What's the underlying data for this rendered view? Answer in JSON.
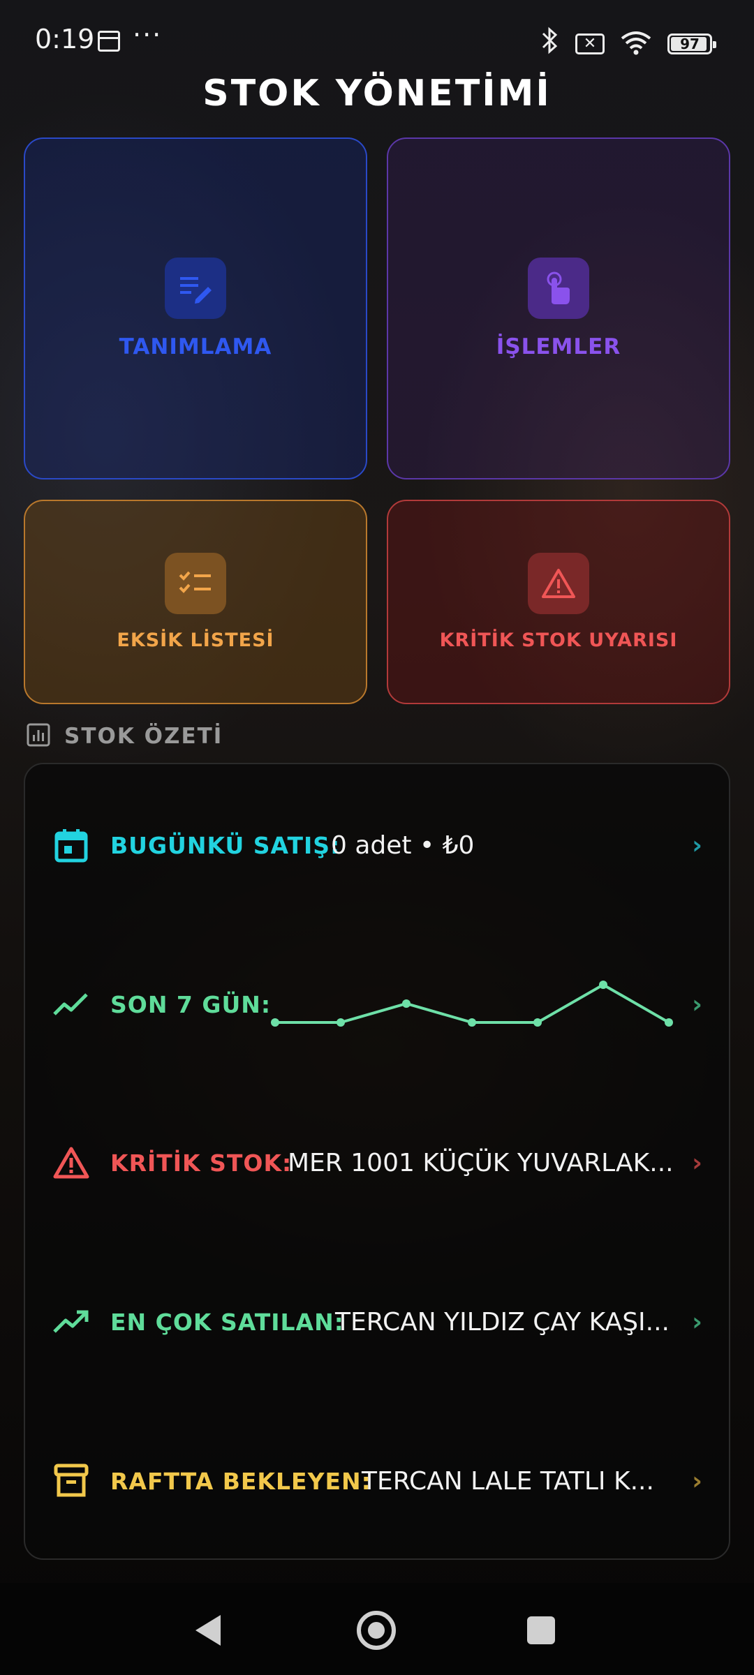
{
  "status_bar": {
    "time": "0:19",
    "dots": "···",
    "battery": "97",
    "icons": [
      "calendar-icon",
      "bluetooth-icon",
      "no-sim-icon",
      "wifi-icon",
      "battery-icon"
    ]
  },
  "header": {
    "title": "STOK YÖNETİMİ"
  },
  "tiles": [
    {
      "label": "TANIMLAMA",
      "icon": "edit-list-icon",
      "color": "#2f58f0"
    },
    {
      "label": "İŞLEMLER",
      "icon": "touch-hand-icon",
      "color": "#8a52ec"
    },
    {
      "label": "EKSİK LİSTESİ",
      "icon": "checklist-icon",
      "color": "#f2a54a"
    },
    {
      "label": "KRİTİK STOK UYARISI",
      "icon": "warning-icon",
      "color": "#f05656"
    }
  ],
  "summary": {
    "title": "STOK ÖZETİ",
    "rows": [
      {
        "label": "BUGÜNKÜ SATIŞ:",
        "value": "0 adet  •  ₺0",
        "color": "#22d3e0",
        "icon": "calendar-icon"
      },
      {
        "label": "SON 7 GÜN:",
        "value": "",
        "color": "#5fdc9a",
        "icon": "trend-icon"
      },
      {
        "label": "KRİTİK STOK:",
        "value": "MER 1001 KÜÇÜK YUVARLAK...",
        "color": "#f05656",
        "icon": "warning-icon"
      },
      {
        "label": "EN ÇOK SATILAN:",
        "value": "TERCAN YILDIZ ÇAY KAŞI...",
        "color": "#5fdc9a",
        "icon": "trending-up-icon"
      },
      {
        "label": "RAFTTA BEKLEYEN:",
        "value": "TERCAN LALE TATLI K...",
        "color": "#f2c84b",
        "icon": "archive-icon"
      }
    ],
    "sparkline": {
      "days": 7,
      "values": [
        0,
        0,
        1,
        0,
        0,
        2,
        0
      ],
      "color": "#6ee0a8"
    }
  },
  "nav": {
    "buttons": [
      "back-button",
      "home-button",
      "recents-button"
    ]
  }
}
